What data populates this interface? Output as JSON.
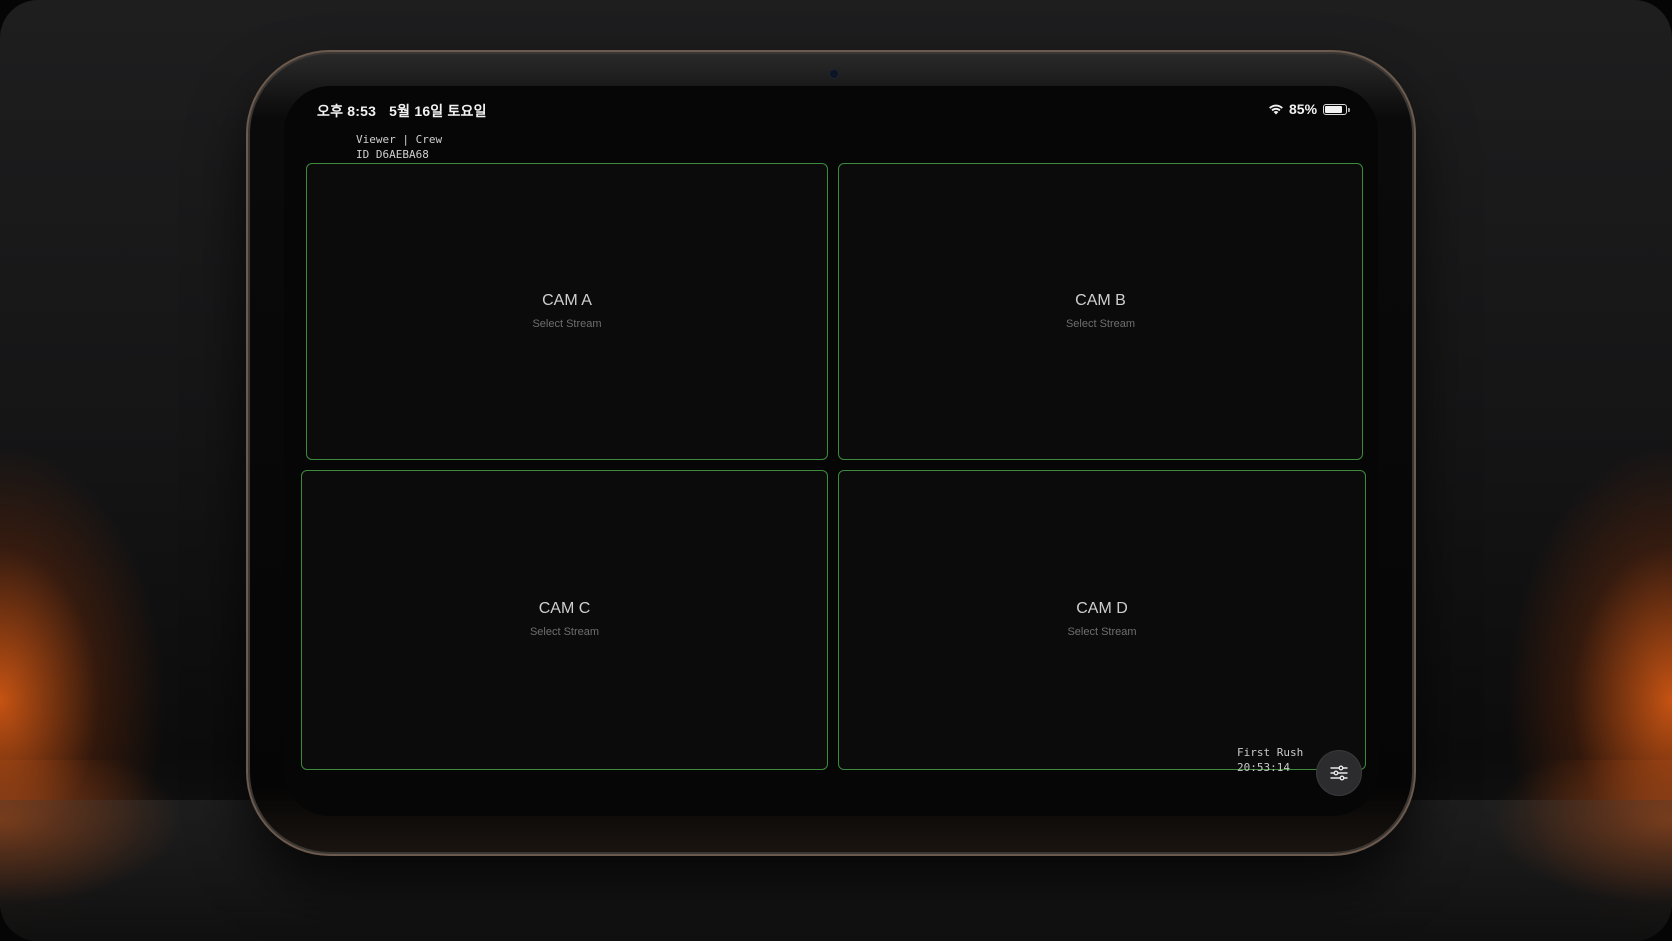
{
  "status_bar": {
    "time": "오후 8:53",
    "date": "5월 16일 토요일",
    "battery": "85%",
    "battery_level": 0.85
  },
  "session": {
    "role_line": "Viewer | Crew",
    "id_line": "ID D6AEBA68"
  },
  "cams": [
    {
      "name": "CAM A",
      "prompt": "Select Stream"
    },
    {
      "name": "CAM B",
      "prompt": "Select Stream"
    },
    {
      "name": "CAM C",
      "prompt": "Select Stream"
    },
    {
      "name": "CAM D",
      "prompt": "Select Stream"
    }
  ],
  "footer": {
    "project": "First Rush",
    "timecode": "20:53:14"
  },
  "icons": {
    "settings": "sliders-icon",
    "wifi": "wifi-icon",
    "battery": "battery-icon"
  },
  "colors": {
    "tile_border": "#3d8a3d",
    "accent_glow": "#e65f14"
  }
}
